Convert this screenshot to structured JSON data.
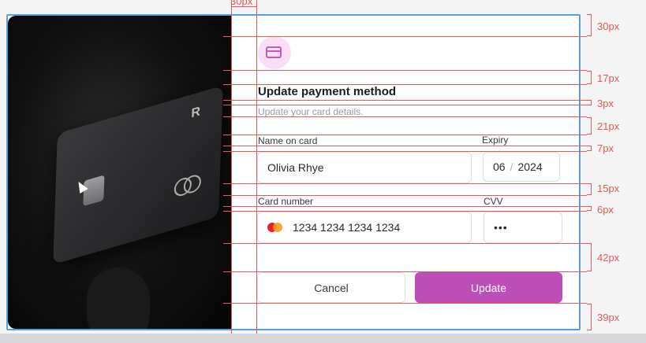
{
  "spec": {
    "top_offset": "30px",
    "dims": [
      "30px",
      "17px",
      "3px",
      "21px",
      "7px",
      "15px",
      "6px",
      "42px",
      "39px"
    ]
  },
  "modal": {
    "title": "Update payment method",
    "subtitle": "Update your card details.",
    "name_label": "Name on card",
    "name_value": "Olivia Rhye",
    "expiry_label": "Expiry",
    "expiry_month": "06",
    "expiry_sep": "/",
    "expiry_year": "2024",
    "card_label": "Card number",
    "card_value": "1234 1234 1234 1234",
    "cvv_label": "CVV",
    "cvv_value": "•••",
    "cancel_label": "Cancel",
    "update_label": "Update"
  },
  "photo": {
    "card_logo": "R"
  },
  "colors": {
    "accent": "#bd4db7",
    "spec_line": "#e25a5a",
    "frame": "#5aa0d6"
  }
}
